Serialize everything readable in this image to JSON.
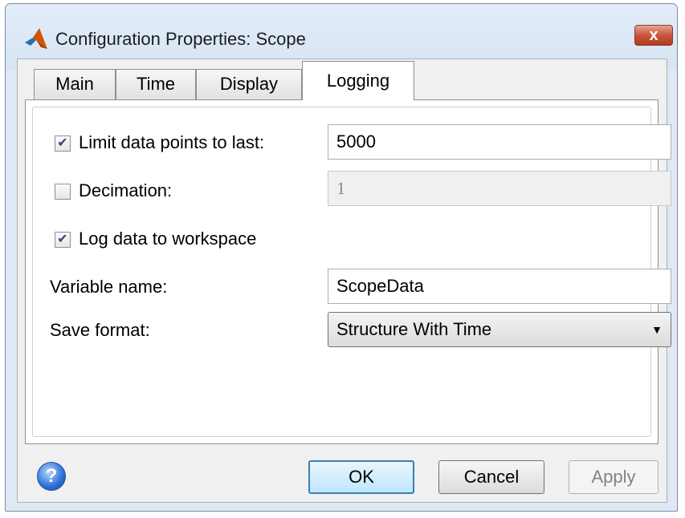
{
  "window": {
    "title": "Configuration Properties: Scope",
    "close_symbol": "x",
    "app_icon": "matlab-logo-icon"
  },
  "tabs": [
    {
      "label": "Main",
      "active": false
    },
    {
      "label": "Time",
      "active": false
    },
    {
      "label": "Display",
      "active": false
    },
    {
      "label": "Logging",
      "active": true
    }
  ],
  "logging": {
    "limit_points": {
      "label": "Limit data points to last:",
      "checked": true,
      "value": "5000"
    },
    "decimation": {
      "label": "Decimation:",
      "checked": false,
      "value": "1",
      "enabled": false
    },
    "log_to_workspace": {
      "label": "Log data to workspace",
      "checked": true
    },
    "variable_name": {
      "label": "Variable name:",
      "value": "ScopeData"
    },
    "save_format": {
      "label": "Save format:",
      "selected": "Structure With Time"
    }
  },
  "buttons": {
    "help_symbol": "?",
    "ok": "OK",
    "cancel": "Cancel",
    "apply": "Apply"
  },
  "colors": {
    "check_mark": "#2f4a7a",
    "default_button_border": "#3c7fb1"
  }
}
